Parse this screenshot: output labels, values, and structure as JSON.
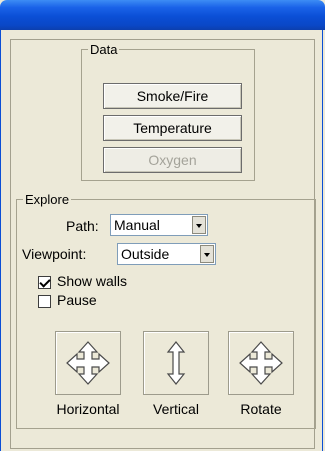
{
  "data_group": {
    "legend": "Data",
    "buttons": {
      "smoke_fire": "Smoke/Fire",
      "temperature": "Temperature",
      "oxygen": "Oxygen"
    }
  },
  "explore_group": {
    "legend": "Explore",
    "path": {
      "label": "Path:",
      "value": "Manual"
    },
    "viewpoint": {
      "label": "Viewpoint:",
      "value": "Outside"
    },
    "show_walls": {
      "label": "Show walls",
      "checked": true
    },
    "pause": {
      "label": "Pause",
      "checked": false
    },
    "tools": {
      "horizontal": "Horizontal",
      "vertical": "Vertical",
      "rotate": "Rotate"
    }
  },
  "colors": {
    "titlebar": "#0b4fd6",
    "window_bg": "#ece9d8",
    "disabled_text": "#a4a39a"
  },
  "icons": {
    "horizontal": "four-way-arrow-icon",
    "vertical": "vertical-double-arrow-icon",
    "rotate": "rotate-four-way-arrow-icon",
    "dropdown": "chevron-down-icon",
    "check": "checkmark-icon"
  }
}
